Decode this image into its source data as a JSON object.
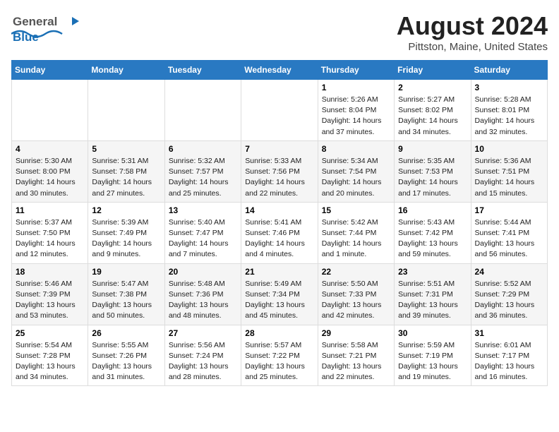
{
  "logo": {
    "general": "General",
    "blue": "Blue"
  },
  "title": "August 2024",
  "subtitle": "Pittston, Maine, United States",
  "weekdays": [
    "Sunday",
    "Monday",
    "Tuesday",
    "Wednesday",
    "Thursday",
    "Friday",
    "Saturday"
  ],
  "weeks": [
    {
      "alt": false,
      "days": [
        {
          "num": "",
          "info": ""
        },
        {
          "num": "",
          "info": ""
        },
        {
          "num": "",
          "info": ""
        },
        {
          "num": "",
          "info": ""
        },
        {
          "num": "1",
          "info": "Sunrise: 5:26 AM\nSunset: 8:04 PM\nDaylight: 14 hours\nand 37 minutes."
        },
        {
          "num": "2",
          "info": "Sunrise: 5:27 AM\nSunset: 8:02 PM\nDaylight: 14 hours\nand 34 minutes."
        },
        {
          "num": "3",
          "info": "Sunrise: 5:28 AM\nSunset: 8:01 PM\nDaylight: 14 hours\nand 32 minutes."
        }
      ]
    },
    {
      "alt": true,
      "days": [
        {
          "num": "4",
          "info": "Sunrise: 5:30 AM\nSunset: 8:00 PM\nDaylight: 14 hours\nand 30 minutes."
        },
        {
          "num": "5",
          "info": "Sunrise: 5:31 AM\nSunset: 7:58 PM\nDaylight: 14 hours\nand 27 minutes."
        },
        {
          "num": "6",
          "info": "Sunrise: 5:32 AM\nSunset: 7:57 PM\nDaylight: 14 hours\nand 25 minutes."
        },
        {
          "num": "7",
          "info": "Sunrise: 5:33 AM\nSunset: 7:56 PM\nDaylight: 14 hours\nand 22 minutes."
        },
        {
          "num": "8",
          "info": "Sunrise: 5:34 AM\nSunset: 7:54 PM\nDaylight: 14 hours\nand 20 minutes."
        },
        {
          "num": "9",
          "info": "Sunrise: 5:35 AM\nSunset: 7:53 PM\nDaylight: 14 hours\nand 17 minutes."
        },
        {
          "num": "10",
          "info": "Sunrise: 5:36 AM\nSunset: 7:51 PM\nDaylight: 14 hours\nand 15 minutes."
        }
      ]
    },
    {
      "alt": false,
      "days": [
        {
          "num": "11",
          "info": "Sunrise: 5:37 AM\nSunset: 7:50 PM\nDaylight: 14 hours\nand 12 minutes."
        },
        {
          "num": "12",
          "info": "Sunrise: 5:39 AM\nSunset: 7:49 PM\nDaylight: 14 hours\nand 9 minutes."
        },
        {
          "num": "13",
          "info": "Sunrise: 5:40 AM\nSunset: 7:47 PM\nDaylight: 14 hours\nand 7 minutes."
        },
        {
          "num": "14",
          "info": "Sunrise: 5:41 AM\nSunset: 7:46 PM\nDaylight: 14 hours\nand 4 minutes."
        },
        {
          "num": "15",
          "info": "Sunrise: 5:42 AM\nSunset: 7:44 PM\nDaylight: 14 hours\nand 1 minute."
        },
        {
          "num": "16",
          "info": "Sunrise: 5:43 AM\nSunset: 7:42 PM\nDaylight: 13 hours\nand 59 minutes."
        },
        {
          "num": "17",
          "info": "Sunrise: 5:44 AM\nSunset: 7:41 PM\nDaylight: 13 hours\nand 56 minutes."
        }
      ]
    },
    {
      "alt": true,
      "days": [
        {
          "num": "18",
          "info": "Sunrise: 5:46 AM\nSunset: 7:39 PM\nDaylight: 13 hours\nand 53 minutes."
        },
        {
          "num": "19",
          "info": "Sunrise: 5:47 AM\nSunset: 7:38 PM\nDaylight: 13 hours\nand 50 minutes."
        },
        {
          "num": "20",
          "info": "Sunrise: 5:48 AM\nSunset: 7:36 PM\nDaylight: 13 hours\nand 48 minutes."
        },
        {
          "num": "21",
          "info": "Sunrise: 5:49 AM\nSunset: 7:34 PM\nDaylight: 13 hours\nand 45 minutes."
        },
        {
          "num": "22",
          "info": "Sunrise: 5:50 AM\nSunset: 7:33 PM\nDaylight: 13 hours\nand 42 minutes."
        },
        {
          "num": "23",
          "info": "Sunrise: 5:51 AM\nSunset: 7:31 PM\nDaylight: 13 hours\nand 39 minutes."
        },
        {
          "num": "24",
          "info": "Sunrise: 5:52 AM\nSunset: 7:29 PM\nDaylight: 13 hours\nand 36 minutes."
        }
      ]
    },
    {
      "alt": false,
      "days": [
        {
          "num": "25",
          "info": "Sunrise: 5:54 AM\nSunset: 7:28 PM\nDaylight: 13 hours\nand 34 minutes."
        },
        {
          "num": "26",
          "info": "Sunrise: 5:55 AM\nSunset: 7:26 PM\nDaylight: 13 hours\nand 31 minutes."
        },
        {
          "num": "27",
          "info": "Sunrise: 5:56 AM\nSunset: 7:24 PM\nDaylight: 13 hours\nand 28 minutes."
        },
        {
          "num": "28",
          "info": "Sunrise: 5:57 AM\nSunset: 7:22 PM\nDaylight: 13 hours\nand 25 minutes."
        },
        {
          "num": "29",
          "info": "Sunrise: 5:58 AM\nSunset: 7:21 PM\nDaylight: 13 hours\nand 22 minutes."
        },
        {
          "num": "30",
          "info": "Sunrise: 5:59 AM\nSunset: 7:19 PM\nDaylight: 13 hours\nand 19 minutes."
        },
        {
          "num": "31",
          "info": "Sunrise: 6:01 AM\nSunset: 7:17 PM\nDaylight: 13 hours\nand 16 minutes."
        }
      ]
    }
  ]
}
